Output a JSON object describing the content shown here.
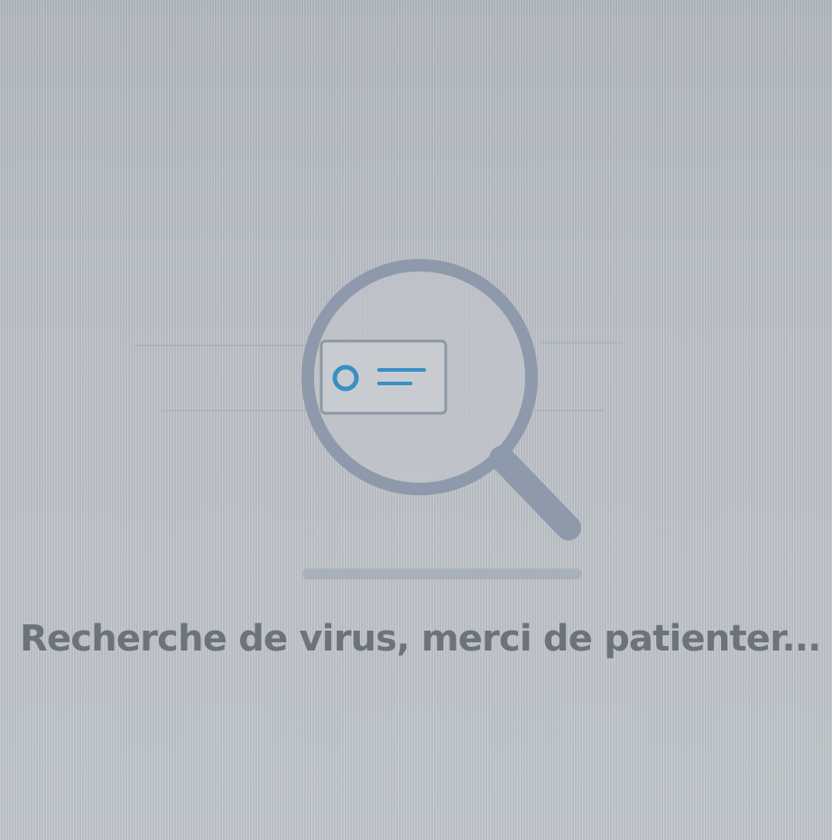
{
  "scan_screen": {
    "status_message": "Recherche de virus, merci de patienter...",
    "icon": "magnifier-scanning-document-icon",
    "colors": {
      "background": "#b9bec4",
      "magnifier": "#8f9bab",
      "accent": "#3a8fc4",
      "text": "#6c737b"
    }
  }
}
